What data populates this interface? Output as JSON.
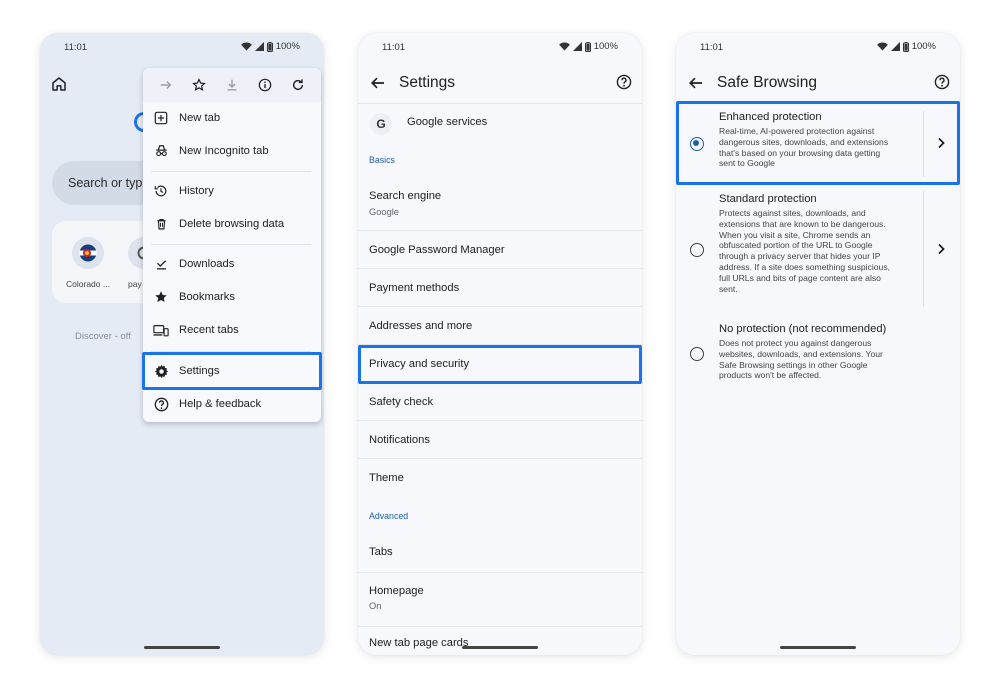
{
  "status": {
    "time": "11:01",
    "battery": "100%"
  },
  "phone1": {
    "search_text": "Search or typ",
    "tiles": [
      {
        "label": "Colorado ..."
      },
      {
        "label": "pay a"
      }
    ],
    "discover": "Discover - off",
    "menu": {
      "toolbar": [
        "forward-icon",
        "star-icon",
        "download-icon",
        "info-icon",
        "refresh-icon"
      ],
      "items": [
        {
          "label": "New tab",
          "icon": "plus-box-icon"
        },
        {
          "label": "New Incognito tab",
          "icon": "incognito-icon"
        },
        {
          "label": "History",
          "icon": "history-icon"
        },
        {
          "label": "Delete browsing data",
          "icon": "trash-icon"
        },
        {
          "label": "Downloads",
          "icon": "download-done-icon"
        },
        {
          "label": "Bookmarks",
          "icon": "star-icon"
        },
        {
          "label": "Recent tabs",
          "icon": "devices-icon"
        },
        {
          "label": "Settings",
          "icon": "gear-icon"
        },
        {
          "label": "Help & feedback",
          "icon": "help-icon"
        }
      ]
    }
  },
  "phone2": {
    "title": "Settings",
    "google_services": "Google services",
    "section_basics": "Basics",
    "search_engine": {
      "title": "Search engine",
      "sub": "Google"
    },
    "items_basic": [
      "Google Password Manager",
      "Payment methods",
      "Addresses and more",
      "Privacy and security",
      "Safety check",
      "Notifications",
      "Theme"
    ],
    "section_advanced": "Advanced",
    "tabs": "Tabs",
    "homepage": {
      "title": "Homepage",
      "sub": "On"
    },
    "cutoff": "New tab page cards"
  },
  "phone3": {
    "title": "Safe Browsing",
    "options": [
      {
        "title": "Enhanced protection",
        "selected": true,
        "desc": [
          "Real-time, AI-powered protection against",
          "dangerous sites, downloads, and extensions",
          "that's based on your browsing data getting",
          "sent to Google"
        ]
      },
      {
        "title": "Standard protection",
        "selected": false,
        "desc": [
          "Protects against sites, downloads, and",
          "extensions that are known to be dangerous.",
          "When you visit a site, Chrome sends an",
          "obfuscated portion of the URL to Google",
          "through a privacy server that hides your IP",
          "address. If a site does something suspicious,",
          "full URLs and bits of page content are also",
          "sent."
        ]
      },
      {
        "title": "No protection (not recommended)",
        "selected": false,
        "desc": [
          "Does not protect you against dangerous",
          "websites, downloads, and extensions. Your",
          "Safe Browsing settings in other Google",
          "products won't be affected."
        ]
      }
    ]
  },
  "colors": {
    "highlight": "#1a73e8",
    "accent": "#1f5ea8"
  }
}
